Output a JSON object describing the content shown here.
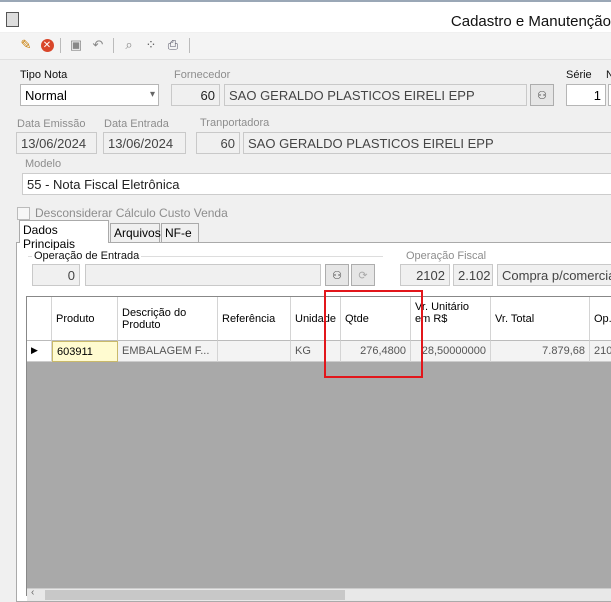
{
  "window": {
    "title": "Cadastro e Manutenção"
  },
  "toolbar": {
    "icons": [
      "new-doc-icon",
      "cancel-icon",
      "save-icon",
      "undo-icon",
      "search-icon",
      "scatter-icon",
      "print-icon"
    ]
  },
  "form": {
    "tipo_nota": {
      "label": "Tipo Nota",
      "value": "Normal"
    },
    "fornecedor": {
      "label": "Fornecedor",
      "code": "60",
      "name": "SAO GERALDO PLASTICOS EIRELI EPP"
    },
    "serie": {
      "label": "Série",
      "value": "1"
    },
    "extra_label": "N",
    "data_emissao": {
      "label": "Data Emissão",
      "value": "13/06/2024"
    },
    "data_entrada": {
      "label": "Data Entrada",
      "value": "13/06/2024"
    },
    "transportadora": {
      "label": "Tranportadora",
      "code": "60",
      "name": "SAO GERALDO PLASTICOS EIRELI EPP"
    },
    "modelo": {
      "label": "Modelo",
      "value": "55 - Nota Fiscal Eletrônica"
    },
    "checkbox": {
      "label": "Desconsiderar Cálculo Custo Venda",
      "checked": false
    }
  },
  "tabs": [
    "Dados Principais",
    "Arquivos",
    "NF-e"
  ],
  "entrada": {
    "op_entrada": {
      "label": "Operação de Entrada",
      "code": "0",
      "value": ""
    },
    "op_fiscal": {
      "label": "Operação Fiscal",
      "code": "2102",
      "cfop": "2.102",
      "desc": "Compra p/comercia"
    }
  },
  "grid": {
    "headers": [
      "Produto",
      "Descrição do Produto",
      "Referência",
      "Unidade",
      "Qtde",
      "Vr. Unitário em R$",
      "Vr. Total",
      "Op."
    ],
    "rows": [
      [
        "603911",
        "EMBALAGEM F...",
        "",
        "KG",
        "276,4800",
        "28,50000000",
        "7.879,68",
        "210"
      ]
    ]
  },
  "colors": {
    "highlight": "#e2161b",
    "selected_cell": "#fffbd0"
  }
}
